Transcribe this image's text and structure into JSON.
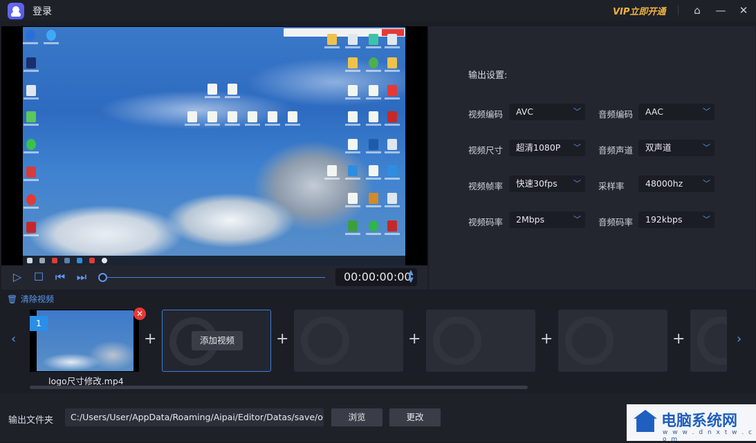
{
  "titlebar": {
    "login_label": "登录",
    "vip_label": "VIP立即开通",
    "icons": [
      "home-icon",
      "minimize-icon",
      "close-icon"
    ]
  },
  "player": {
    "timecode": "00:00:00:00",
    "controls": [
      "play-icon",
      "stop-icon",
      "prev-frame-icon",
      "next-frame-icon"
    ]
  },
  "settings": {
    "title": "输出设置:",
    "rows": [
      {
        "left_label": "视频编码",
        "left_value": "AVC",
        "right_label": "音频编码",
        "right_value": "AAC"
      },
      {
        "left_label": "视频尺寸",
        "left_value": "超清1080P",
        "right_label": "音频声道",
        "right_value": "双声道"
      },
      {
        "left_label": "视频帧率",
        "left_value": "快速30fps",
        "right_label": "采样率",
        "right_value": "48000hz"
      },
      {
        "left_label": "视频码率",
        "left_value": "2Mbps",
        "right_label": "音频码率",
        "right_value": "192kbps"
      }
    ]
  },
  "timeline": {
    "clear_label": "清除视频",
    "clip_index": "1",
    "clip_name": "logo尺寸修改.mp4",
    "add_video_label": "添加视频",
    "plus_symbol": "+",
    "accent": "#5b9bf0"
  },
  "output": {
    "folder_label": "输出文件夹",
    "path": "C:/Users/User/AppData/Roaming/Aipai/Editor/Datas/save/outp",
    "browse_label": "浏览",
    "change_label": "更改"
  },
  "watermark": {
    "text": "电脑系统网",
    "url": "w w w . d n x t w . c o m"
  }
}
